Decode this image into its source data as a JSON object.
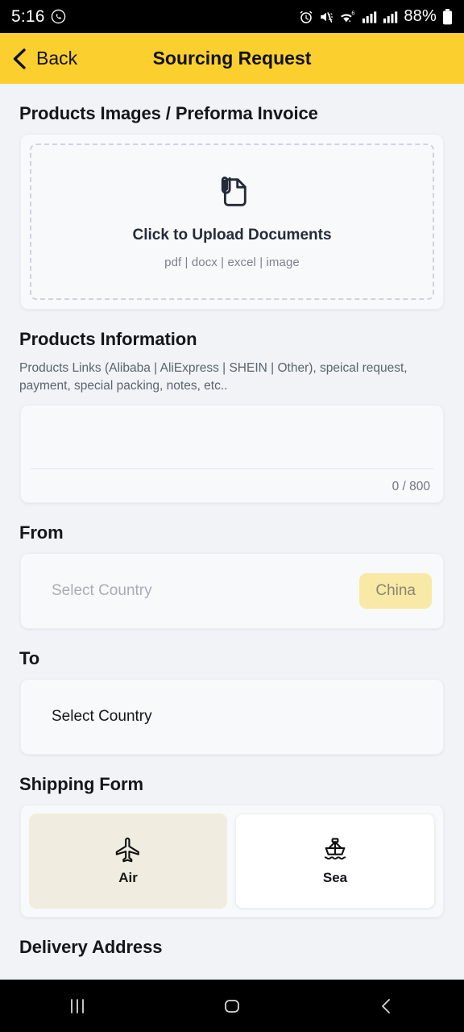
{
  "status_bar": {
    "time": "5:16",
    "battery_percent": "88%",
    "icons": [
      "whatsapp-icon",
      "alarm-icon",
      "mute-icon",
      "wifi-icon",
      "signal-sim1-icon",
      "signal-sim2-icon",
      "battery-icon"
    ]
  },
  "app_bar": {
    "back_label": "Back",
    "title": "Sourcing Request",
    "background_color": "#fbd02e"
  },
  "upload_section": {
    "title": "Products Images / Preforma Invoice",
    "cta": "Click to Upload Documents",
    "formats": "pdf | docx | excel | image",
    "icon": "document-attachment-icon"
  },
  "products_information": {
    "title": "Products Information",
    "description": "Products Links (Alibaba | AliExpress | SHEIN | Other), speical request, payment, special packing, notes, etc..",
    "textarea_value": "",
    "textarea_placeholder": "",
    "char_counter": "0 / 800"
  },
  "from": {
    "label": "From",
    "placeholder": "Select Country",
    "chip_label": "China",
    "chip_color": "#f8e9a6"
  },
  "to": {
    "label": "To",
    "value": "Select Country"
  },
  "shipping_form": {
    "label": "Shipping Form",
    "options": [
      {
        "label": "Air",
        "icon": "airplane-icon",
        "selected": true
      },
      {
        "label": "Sea",
        "icon": "ship-icon",
        "selected": false
      }
    ]
  },
  "delivery_address": {
    "title": "Delivery Address"
  },
  "nav_bar": {
    "recents_label": "recents-icon",
    "home_label": "home-icon",
    "back_label": "back-icon"
  }
}
